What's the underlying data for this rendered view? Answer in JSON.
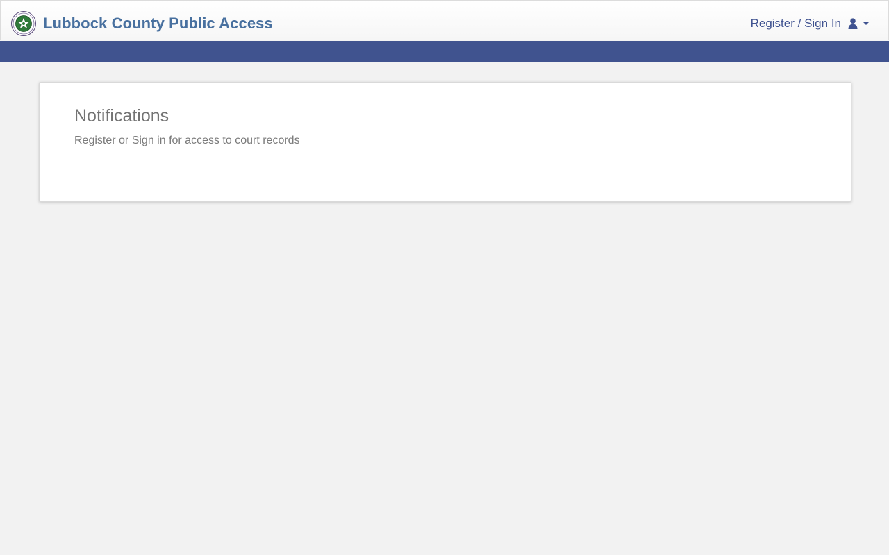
{
  "header": {
    "seal_icon": "county-seal-icon",
    "title": "Lubbock County Public Access",
    "title_color": "#48709f",
    "account_label": "Register / Sign In",
    "account_icon": "user-icon",
    "account_caret_icon": "caret-down-icon",
    "account_color": "#3f5290"
  },
  "band": {
    "color": "#40538f"
  },
  "notifications": {
    "title": "Notifications",
    "message": "Register or Sign in for access to court records"
  }
}
